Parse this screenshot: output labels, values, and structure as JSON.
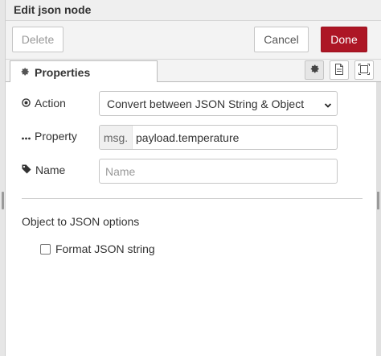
{
  "window": {
    "title": "Edit json node"
  },
  "toolbar": {
    "delete_label": "Delete",
    "cancel_label": "Cancel",
    "done_label": "Done"
  },
  "tabs": {
    "active_label": "Properties",
    "icons": [
      "gear-icon",
      "document-icon",
      "frame-icon"
    ]
  },
  "form": {
    "action": {
      "label": "Action",
      "value": "Convert between JSON String & Object"
    },
    "property": {
      "label": "Property",
      "prefix": "msg.",
      "value": "payload.temperature"
    },
    "name": {
      "label": "Name",
      "value": "",
      "placeholder": "Name"
    }
  },
  "options": {
    "section_title": "Object to JSON options",
    "format_label": "Format JSON string",
    "format_checked": false
  },
  "colors": {
    "done_bg": "#ad1625",
    "border": "#c6c6c6"
  }
}
